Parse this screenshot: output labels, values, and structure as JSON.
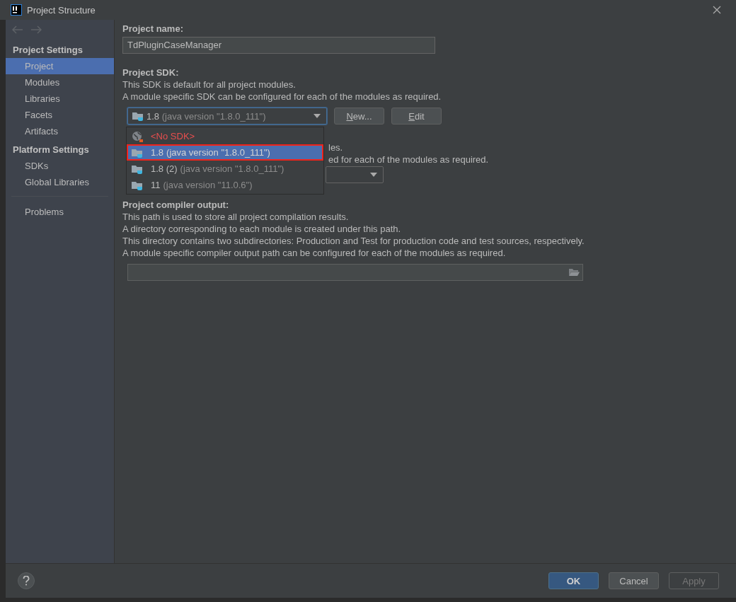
{
  "window": {
    "title": "Project Structure"
  },
  "sidebar": {
    "sections": [
      {
        "title": "Project Settings",
        "items": [
          {
            "label": "Project",
            "selected": true
          },
          {
            "label": "Modules",
            "selected": false
          },
          {
            "label": "Libraries",
            "selected": false
          },
          {
            "label": "Facets",
            "selected": false
          },
          {
            "label": "Artifacts",
            "selected": false
          }
        ]
      },
      {
        "title": "Platform Settings",
        "items": [
          {
            "label": "SDKs",
            "selected": false
          },
          {
            "label": "Global Libraries",
            "selected": false
          }
        ]
      }
    ],
    "extra_items": [
      {
        "label": "Problems",
        "selected": false
      }
    ]
  },
  "project_name": {
    "label": "Project name:",
    "value": "TdPluginCaseManager"
  },
  "project_sdk": {
    "label": "Project SDK:",
    "description": [
      "This SDK is default for all project modules.",
      "A module specific SDK can be configured for each of the modules as required."
    ],
    "dropdown": {
      "version": "1.8",
      "detail": "(java version \"1.8.0_111\")",
      "expanded": true
    },
    "buttons": [
      "New...",
      "Edit"
    ]
  },
  "sdk_popup": [
    {
      "kind": "none",
      "name": "<No SDK>",
      "selected": false,
      "framed": false
    },
    {
      "kind": "jdk",
      "name": "1.8",
      "detail": "(java version \"1.8.0_111\")",
      "selected": true,
      "framed": true
    },
    {
      "kind": "jdk",
      "name": "1.8 (2)",
      "detail": "(java version \"1.8.0_111\")",
      "selected": false,
      "framed": false
    },
    {
      "kind": "jdk",
      "name": "11",
      "detail": "(java version \"11.0.6\")",
      "selected": false,
      "framed": false
    }
  ],
  "language_level": {
    "lines": [
      {
        "right": "les."
      },
      {
        "right": "ed for each of the modules as required."
      }
    ]
  },
  "compiler_output": {
    "label": "Project compiler output:",
    "description": [
      "This path is used to store all project compilation results.",
      "A directory corresponding to each module is created under this path.",
      "This directory contains two subdirectories: Production and Test for production code and test sources, respectively.",
      "A module specific compiler output path can be configured for each of the modules as required."
    ]
  },
  "footer": {
    "buttons": [
      {
        "label": "OK",
        "kind": "default",
        "disabled": false
      },
      {
        "label": "Cancel",
        "kind": "normal",
        "disabled": false
      },
      {
        "label": "Apply",
        "kind": "normal",
        "disabled": true
      }
    ]
  }
}
